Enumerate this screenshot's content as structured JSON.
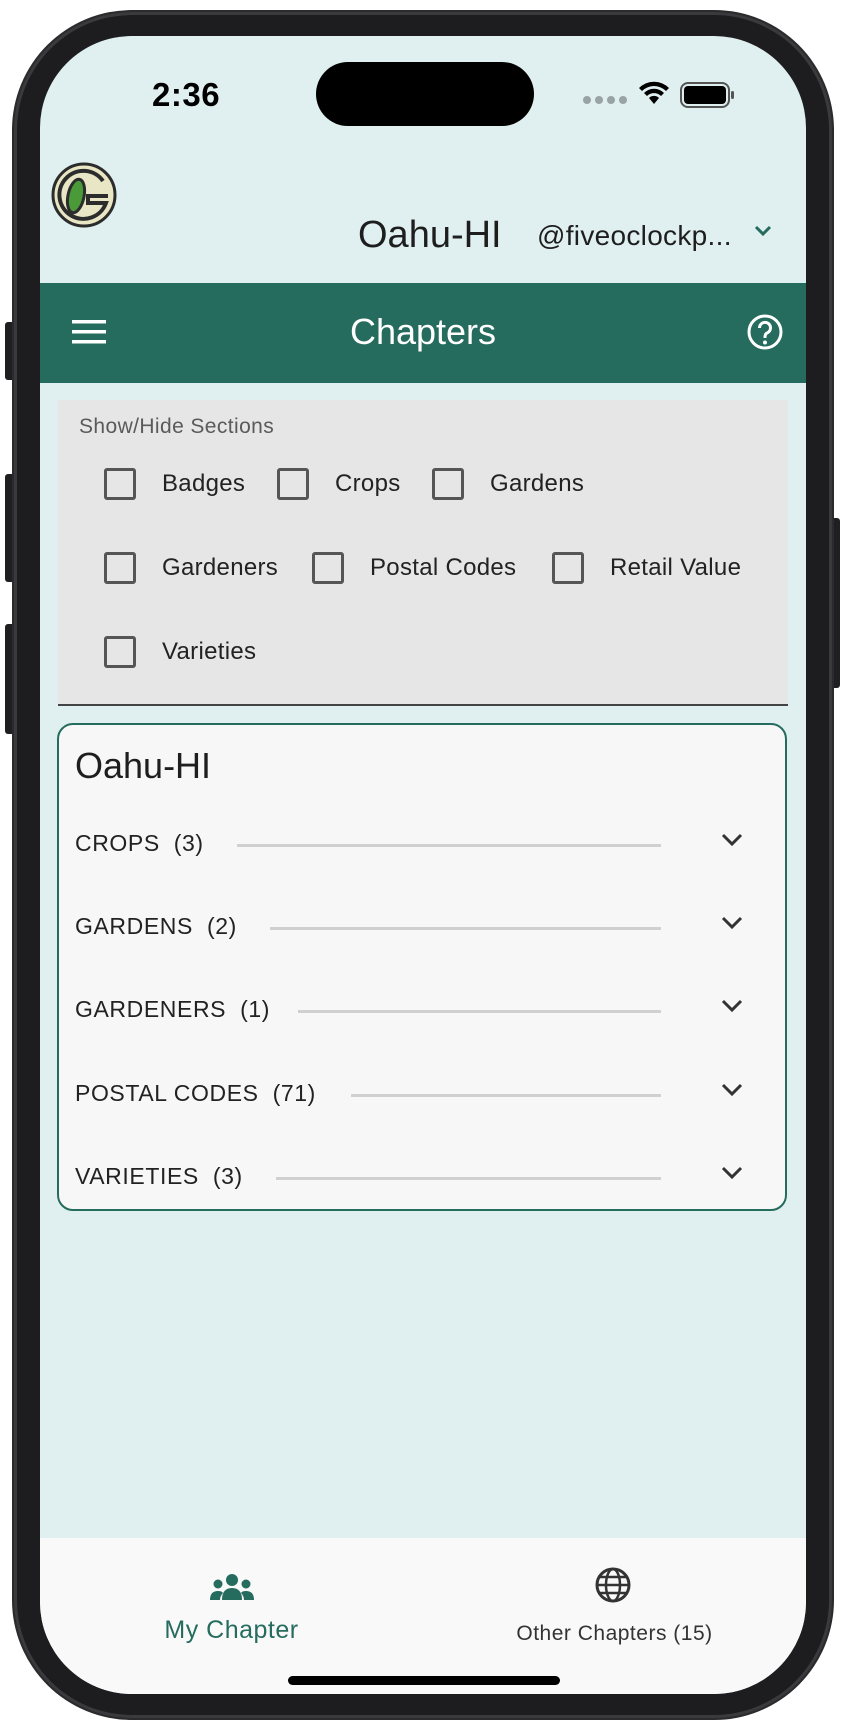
{
  "status_bar": {
    "time": "2:36"
  },
  "header": {
    "chapter_name": "Oahu-HI",
    "user_handle": "@fiveoclockp...",
    "user_menu_icon": "chevron-down-icon"
  },
  "toolbar": {
    "title": "Chapters",
    "menu_icon": "hamburger-menu-icon",
    "help_icon": "help-circle-icon",
    "background_color": "#256b5e"
  },
  "sections_panel": {
    "label": "Show/Hide Sections",
    "options": [
      {
        "label": "Badges",
        "checked": false
      },
      {
        "label": "Crops",
        "checked": false
      },
      {
        "label": "Gardens",
        "checked": false
      },
      {
        "label": "Gardeners",
        "checked": false
      },
      {
        "label": "Postal Codes",
        "checked": false
      },
      {
        "label": "Retail Value",
        "checked": false
      },
      {
        "label": "Varieties",
        "checked": false
      }
    ]
  },
  "chapter_card": {
    "title": "Oahu-HI",
    "sections": [
      {
        "label": "CROPS",
        "count": "(3)"
      },
      {
        "label": "GARDENS",
        "count": "(2)"
      },
      {
        "label": "GARDENERS",
        "count": "(1)"
      },
      {
        "label": "POSTAL CODES",
        "count": "(71)"
      },
      {
        "label": "VARIETIES",
        "count": "(3)"
      }
    ]
  },
  "bottom_nav": {
    "items": [
      {
        "label": "My Chapter",
        "icon": "group-icon",
        "active": true
      },
      {
        "label": "Other Chapters (15)",
        "icon": "globe-icon",
        "active": false
      }
    ],
    "active_color": "#256b5e"
  }
}
